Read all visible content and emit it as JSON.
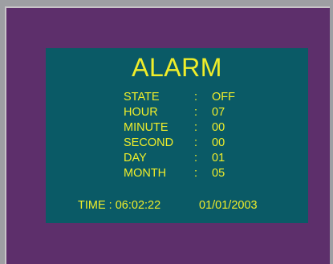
{
  "screen": {
    "title": "ALARM",
    "fields": [
      {
        "label": "STATE",
        "separator": ":",
        "value": "OFF"
      },
      {
        "label": "HOUR",
        "separator": ":",
        "value": "07"
      },
      {
        "label": "MINUTE",
        "separator": ":",
        "value": "00"
      },
      {
        "label": "SECOND",
        "separator": ":",
        "value": "00"
      },
      {
        "label": "DAY",
        "separator": ":",
        "value": "01"
      },
      {
        "label": "MONTH",
        "separator": ":",
        "value": "05"
      }
    ],
    "time_readout": "TIME : 06:02:22",
    "date_readout": "01/01/2003"
  },
  "colors": {
    "outer_background": "#9e9fa3",
    "frame": "#5d2f6b",
    "panel": "#0a5a66",
    "text": "#f0ee2a"
  }
}
